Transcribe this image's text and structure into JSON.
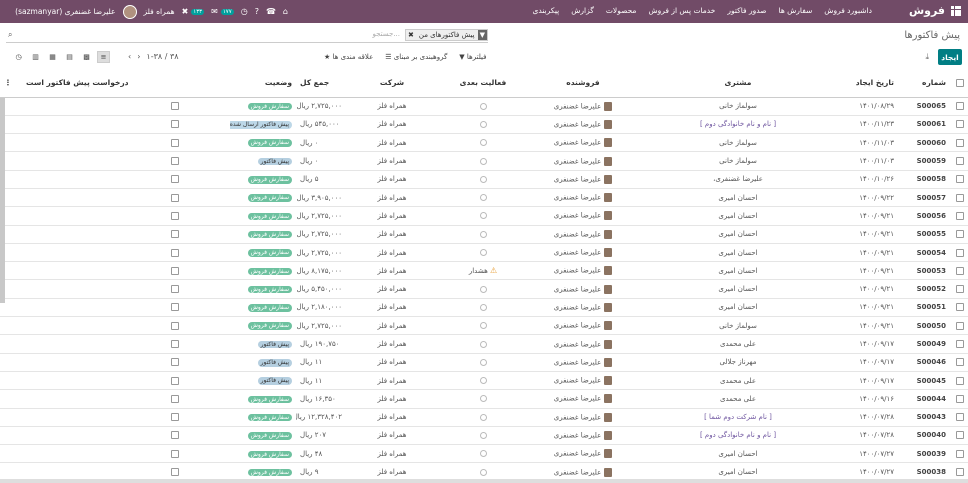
{
  "topbar": {
    "app_name": "فروش",
    "menu": [
      "داشبورد فروش",
      "سفارش ها",
      "صدور فاکتور",
      "خدمات پس از فروش",
      "محصولات",
      "گزارش",
      "پیکربندی"
    ],
    "company": "همراه فلز",
    "user": "علیرضا غضنفری (sazmanyar)",
    "badge_activities": "۱۳۳",
    "badge_messages": "۱۷۷"
  },
  "breadcrumb": "پیش فاکتورها",
  "search": {
    "facet_label": "پیش فاکتورهای من",
    "placeholder": "جستجو..."
  },
  "toolbar": {
    "create_label": "ایجاد",
    "filters_label": "فیلترها",
    "groupby_label": "گروهبندی بر مبنای",
    "favorites_label": "علاقه مندی ها",
    "pager": "۱-۳۸ / ۳۸"
  },
  "columns": [
    "شماره",
    "تاریخ ایجاد",
    "مشتری",
    "فروشنده",
    "فعالیت بعدی",
    "شرکت",
    "جمع کل",
    "وضعیت",
    "درخواست پیش فاکتور است"
  ],
  "rows": [
    {
      "num": "S00065",
      "date": "۱۴۰۱/۰۸/۲۹",
      "customer": "سولماز خانی",
      "salesperson": "علیرضا غضنفری",
      "activity": "",
      "company": "همراه فلز",
      "total": "۲,۷۲۵,۰۰۰ ریال",
      "status": "سفارش فروش",
      "status_type": "sale"
    },
    {
      "num": "S00061",
      "date": "۱۴۰۰/۱۱/۲۳",
      "customer": "[ نام و نام خانوادگی دوم ]",
      "salesperson": "علیرضا غضنفری",
      "activity": "",
      "company": "همراه فلز",
      "total": "۵۴۵,۰۰۰ ریال",
      "status": "پیش فاکتور ارسال شده",
      "status_type": "sent"
    },
    {
      "num": "S00060",
      "date": "۱۴۰۰/۱۱/۰۳",
      "customer": "سولماز خانی",
      "salesperson": "علیرضا غضنفری",
      "activity": "",
      "company": "همراه فلز",
      "total": "۰ ریال",
      "status": "سفارش فروش",
      "status_type": "sale"
    },
    {
      "num": "S00059",
      "date": "۱۴۰۰/۱۱/۰۳",
      "customer": "سولماز خانی",
      "salesperson": "علیرضا غضنفری",
      "activity": "",
      "company": "همراه فلز",
      "total": "۰ ریال",
      "status": "پیش فاکتور",
      "status_type": "quote"
    },
    {
      "num": "S00058",
      "date": "۱۴۰۰/۱۰/۲۶",
      "customer": "علیرضا غضنفری،",
      "salesperson": "علیرضا غضنفری",
      "activity": "",
      "company": "همراه فلز",
      "total": "۵ ریال",
      "status": "سفارش فروش",
      "status_type": "sale"
    },
    {
      "num": "S00057",
      "date": "۱۴۰۰/۰۹/۲۲",
      "customer": "احسان امیری",
      "salesperson": "علیرضا غضنفری",
      "activity": "",
      "company": "همراه فلز",
      "total": "۳,۹۰۵,۰۰۰ ریال",
      "status": "سفارش فروش",
      "status_type": "sale"
    },
    {
      "num": "S00056",
      "date": "۱۴۰۰/۰۹/۲۱",
      "customer": "احسان امیری",
      "salesperson": "علیرضا غضنفری",
      "activity": "",
      "company": "همراه فلز",
      "total": "۲,۷۲۵,۰۰۰ ریال",
      "status": "سفارش فروش",
      "status_type": "sale"
    },
    {
      "num": "S00055",
      "date": "۱۴۰۰/۰۹/۲۱",
      "customer": "احسان امیری",
      "salesperson": "علیرضا غضنفری",
      "activity": "",
      "company": "همراه فلز",
      "total": "۲,۷۲۵,۰۰۰ ریال",
      "status": "سفارش فروش",
      "status_type": "sale"
    },
    {
      "num": "S00054",
      "date": "۱۴۰۰/۰۹/۲۱",
      "customer": "احسان امیری",
      "salesperson": "علیرضا غضنفری",
      "activity": "",
      "company": "همراه فلز",
      "total": "۲,۷۲۵,۰۰۰ ریال",
      "status": "سفارش فروش",
      "status_type": "sale"
    },
    {
      "num": "S00053",
      "date": "۱۴۰۰/۰۹/۲۱",
      "customer": "احسان امیری",
      "salesperson": "علیرضا غضنفری",
      "activity": "هشدار",
      "company": "همراه فلز",
      "total": "۸,۱۷۵,۰۰۰ ریال",
      "status": "سفارش فروش",
      "status_type": "sale"
    },
    {
      "num": "S00052",
      "date": "۱۴۰۰/۰۹/۲۱",
      "customer": "احسان امیری",
      "salesperson": "علیرضا غضنفری",
      "activity": "",
      "company": "همراه فلز",
      "total": "۵,۴۵۰,۰۰۰ ریال",
      "status": "سفارش فروش",
      "status_type": "sale"
    },
    {
      "num": "S00051",
      "date": "۱۴۰۰/۰۹/۲۱",
      "customer": "احسان امیری",
      "salesperson": "علیرضا غضنفری",
      "activity": "",
      "company": "همراه فلز",
      "total": "۲,۱۸۰,۰۰۰ ریال",
      "status": "سفارش فروش",
      "status_type": "sale"
    },
    {
      "num": "S00050",
      "date": "۱۴۰۰/۰۹/۲۱",
      "customer": "سولماز خانی",
      "salesperson": "علیرضا غضنفری",
      "activity": "",
      "company": "همراه فلز",
      "total": "۲,۷۲۵,۰۰۰ ریال",
      "status": "سفارش فروش",
      "status_type": "sale"
    },
    {
      "num": "S00049",
      "date": "۱۴۰۰/۰۹/۱۷",
      "customer": "علی محمدی",
      "salesperson": "علیرضا غضنفری",
      "activity": "",
      "company": "همراه فلز",
      "total": "۱۹۰,۷۵۰ ریال",
      "status": "پیش فاکتور",
      "status_type": "quote"
    },
    {
      "num": "S00046",
      "date": "۱۴۰۰/۰۹/۱۷",
      "customer": "مهرناز جلالی",
      "salesperson": "علیرضا غضنفری",
      "activity": "",
      "company": "همراه فلز",
      "total": "۱۱ ریال",
      "status": "پیش فاکتور",
      "status_type": "quote"
    },
    {
      "num": "S00045",
      "date": "۱۴۰۰/۰۹/۱۷",
      "customer": "علی محمدی",
      "salesperson": "علیرضا غضنفری",
      "activity": "",
      "company": "همراه فلز",
      "total": "۱۱ ریال",
      "status": "پیش فاکتور",
      "status_type": "quote"
    },
    {
      "num": "S00044",
      "date": "۱۴۰۰/۰۹/۱۶",
      "customer": "علی محمدی",
      "salesperson": "علیرضا غضنفری",
      "activity": "",
      "company": "همراه فلز",
      "total": "۱۶,۳۵۰ ریال",
      "status": "سفارش فروش",
      "status_type": "sale"
    },
    {
      "num": "S00043",
      "date": "۱۴۰۰/۰۷/۲۸",
      "customer": "[ نام شرکت دوم شما ]",
      "salesperson": "علیرضا غضنفری",
      "activity": "",
      "company": "همراه فلز",
      "total": "۱۲,۳۲۸,۴۰۲ ریال",
      "status": "سفارش فروش",
      "status_type": "sale"
    },
    {
      "num": "S00040",
      "date": "۱۴۰۰/۰۷/۲۸",
      "customer": "[ نام و نام خانوادگی دوم ]",
      "salesperson": "علیرضا غضنفری",
      "activity": "",
      "company": "همراه فلز",
      "total": "۲۰۷ ریال",
      "status": "سفارش فروش",
      "status_type": "sale"
    },
    {
      "num": "S00039",
      "date": "۱۴۰۰/۰۷/۲۷",
      "customer": "احسان امیری",
      "salesperson": "علیرضا غضنفری",
      "activity": "",
      "company": "همراه فلز",
      "total": "۴۸ ریال",
      "status": "سفارش فروش",
      "status_type": "sale"
    },
    {
      "num": "S00038",
      "date": "۱۴۰۰/۰۷/۲۷",
      "customer": "احسان امیری",
      "salesperson": "علیرضا غضنفری",
      "activity": "",
      "company": "همراه فلز",
      "total": "۹ ریال",
      "status": "سفارش فروش",
      "status_type": "sale"
    }
  ]
}
